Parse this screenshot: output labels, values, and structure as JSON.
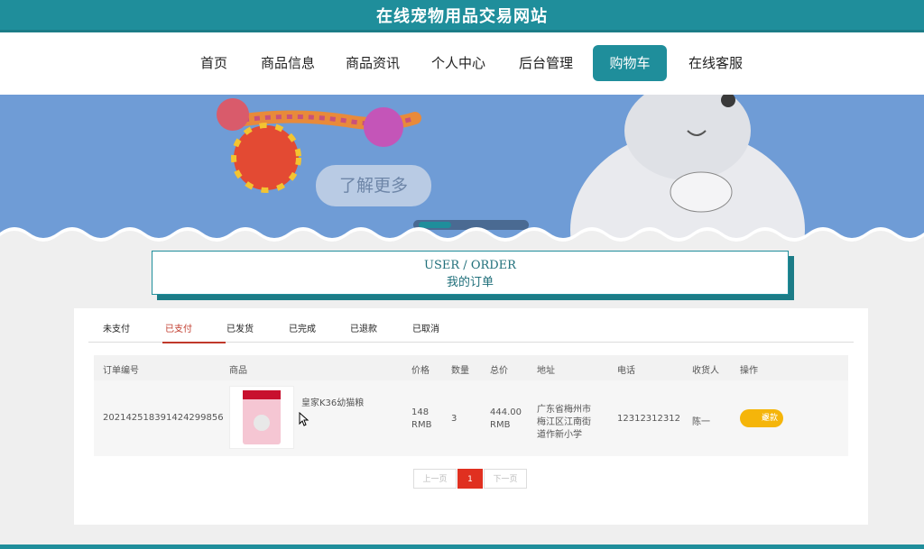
{
  "header": {
    "site_title": "在线宠物用品交易网站"
  },
  "nav": {
    "items": [
      {
        "label": "首页"
      },
      {
        "label": "商品信息"
      },
      {
        "label": "商品资讯"
      },
      {
        "label": "个人中心"
      },
      {
        "label": "后台管理"
      },
      {
        "label": "购物车",
        "active": true
      },
      {
        "label": "在线客服"
      }
    ]
  },
  "banner": {
    "button_label": "了解更多"
  },
  "section": {
    "title_en": "USER / ORDER",
    "title_cn": "我的订单"
  },
  "tabs": [
    {
      "label": "未支付"
    },
    {
      "label": "已支付",
      "active": true
    },
    {
      "label": "已发货"
    },
    {
      "label": "已完成"
    },
    {
      "label": "已退款"
    },
    {
      "label": "已取消"
    }
  ],
  "table": {
    "headers": [
      "订单编号",
      "商品",
      "价格",
      "数量",
      "总价",
      "地址",
      "电话",
      "收货人",
      "操作"
    ],
    "rows": [
      {
        "order_id": "20214251839142429985​6",
        "product_name": "皇家K36幼猫粮",
        "price_line1": "148",
        "price_line2": "RMB",
        "quantity": "3",
        "total_line1": "444.00",
        "total_line2": "RMB",
        "address_line1": "广东省梅州市",
        "address_line2": "梅江区江南街",
        "address_line3": "道作新小学",
        "phone": "12312312312",
        "receiver": "陈一",
        "action_label": "退款"
      }
    ]
  },
  "pagination": {
    "prev": "上一页",
    "current": "1",
    "next": "下一页"
  },
  "colors": {
    "primary": "#1f8e9b",
    "accent_red": "#e03020",
    "refund": "#f5b50a"
  }
}
